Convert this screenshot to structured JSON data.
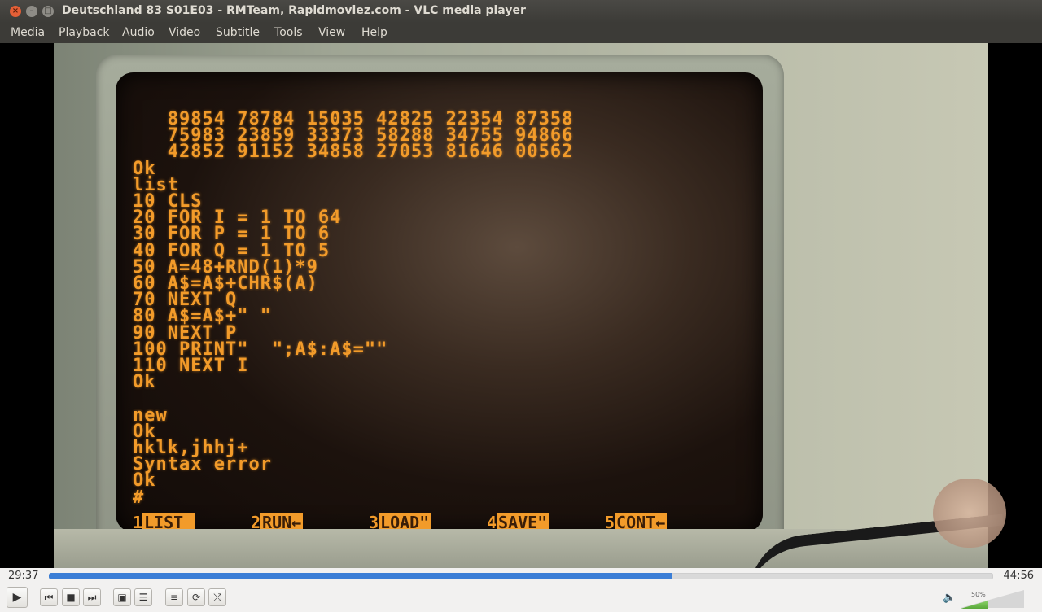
{
  "window": {
    "title": "Deutschland 83 S01E03 - RMTeam, Rapidmoviez.com - VLC media player"
  },
  "menu": [
    {
      "u": "M",
      "rest": "edia"
    },
    {
      "u": "P",
      "rest": "layback"
    },
    {
      "u": "A",
      "rest": "udio"
    },
    {
      "u": "V",
      "rest": "ideo"
    },
    {
      "u": "S",
      "rest": "ubtitle"
    },
    {
      "u": "T",
      "rest": "ools"
    },
    {
      "u": "V",
      "rest": "iew"
    },
    {
      "u": "H",
      "rest": "elp"
    }
  ],
  "screen": {
    "lines": [
      "   89854 78784 15035 42825 22354 87358",
      "   75983 23859 33373 58288 34755 94866",
      "   42852 91152 34858 27053 81646 00562",
      "Ok",
      "list",
      "10 CLS",
      "20 FOR I = 1 TO 64",
      "30 FOR P = 1 TO 6",
      "40 FOR Q = 1 TO 5",
      "50 A=48+RND(1)*9",
      "60 A$=A$+CHR$(A)",
      "70 NEXT Q",
      "80 A$=A$+\" \"",
      "90 NEXT P",
      "100 PRINT\"  \";A$:A$=\"\"",
      "110 NEXT I",
      "Ok",
      "",
      "new",
      "Ok",
      "hklk,jhhj+",
      "Syntax error",
      "Ok",
      "#"
    ],
    "fkeys": [
      {
        "num": "1",
        "label": "LIST "
      },
      {
        "num": "2",
        "label": "RUN←"
      },
      {
        "num": "3",
        "label": "LOAD\""
      },
      {
        "num": "4",
        "label": "SAVE\""
      },
      {
        "num": "5",
        "label": "CONT←"
      }
    ]
  },
  "player": {
    "elapsed": "29:37",
    "total": "44:56",
    "progress_fraction": 0.6592,
    "volume_label": "50%",
    "volume_fraction": 0.5
  },
  "icons": {
    "play": "play-icon",
    "previous": "previous-icon",
    "stop": "stop-icon",
    "next": "next-icon",
    "fullscreen": "fullscreen-icon",
    "extended": "extended-settings-icon",
    "playlist": "playlist-icon",
    "loop": "loop-icon",
    "random": "random-icon",
    "volume": "speaker-icon"
  },
  "colors": {
    "seek_fill": "#3b7ed6",
    "crt_text": "#f29b2a",
    "close_button": "#e45f36"
  }
}
